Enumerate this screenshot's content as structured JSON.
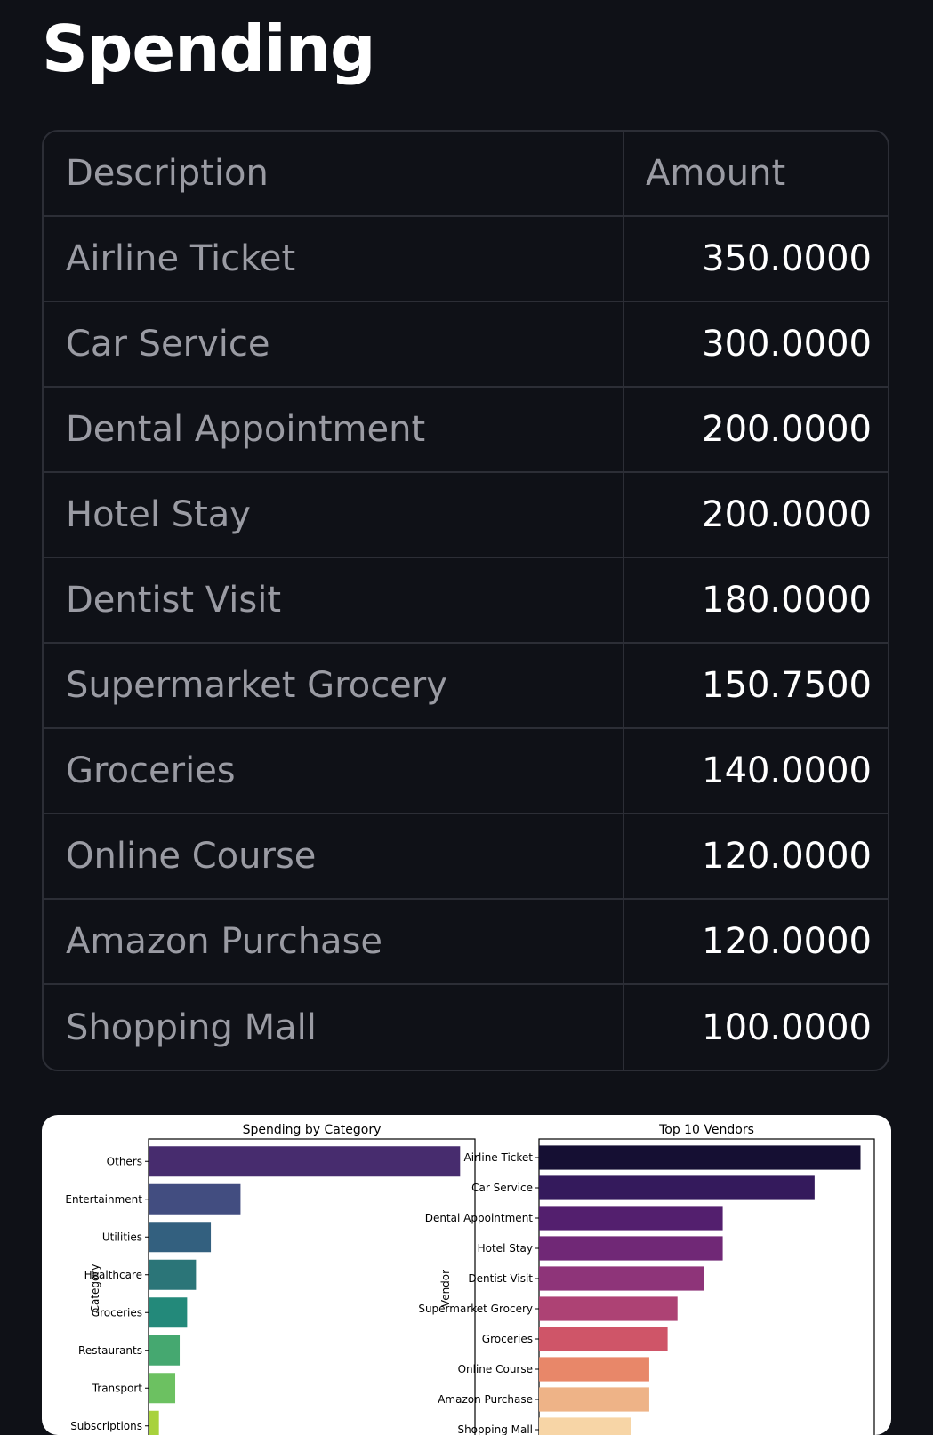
{
  "page": {
    "title": "Spending"
  },
  "table": {
    "headers": [
      "Description",
      "Amount"
    ],
    "rows": [
      {
        "description": "Airline Ticket",
        "amount": "350.0000"
      },
      {
        "description": "Car Service",
        "amount": "300.0000"
      },
      {
        "description": "Dental Appointment",
        "amount": "200.0000"
      },
      {
        "description": "Hotel Stay",
        "amount": "200.0000"
      },
      {
        "description": "Dentist Visit",
        "amount": "180.0000"
      },
      {
        "description": "Supermarket Grocery",
        "amount": "150.7500"
      },
      {
        "description": "Groceries",
        "amount": "140.0000"
      },
      {
        "description": "Online Course",
        "amount": "120.0000"
      },
      {
        "description": "Amazon Purchase",
        "amount": "120.0000"
      },
      {
        "description": "Shopping Mall",
        "amount": "100.0000"
      }
    ]
  },
  "chart_data": [
    {
      "type": "bar",
      "orientation": "horizontal",
      "title": "Spending by Category",
      "ylabel": "Category",
      "xlabel": "",
      "categories": [
        "Others",
        "Entertainment",
        "Utilities",
        "Healthcare",
        "Groceries",
        "Restaurants",
        "Transport",
        "Subscriptions"
      ],
      "values": [
        1050,
        310,
        210,
        160,
        130,
        105,
        90,
        35
      ],
      "xlim": [
        0,
        1100
      ],
      "colors": [
        "#472c6e",
        "#424d80",
        "#33607f",
        "#2b7578",
        "#23897a",
        "#45a870",
        "#6cc161",
        "#a8d23c"
      ]
    },
    {
      "type": "bar",
      "orientation": "horizontal",
      "title": "Top 10 Vendors",
      "ylabel": "Vendor",
      "xlabel": "",
      "categories": [
        "Airline Ticket",
        "Car Service",
        "Dental Appointment",
        "Hotel Stay",
        "Dentist Visit",
        "Supermarket Grocery",
        "Groceries",
        "Online Course",
        "Amazon Purchase",
        "Shopping Mall"
      ],
      "values": [
        350,
        300,
        200,
        200,
        180,
        150.75,
        140,
        120,
        120,
        100
      ],
      "xlim": [
        0,
        365
      ],
      "colors": [
        "#150f33",
        "#341a5c",
        "#531f6e",
        "#702876",
        "#8e3479",
        "#ad4274",
        "#cf5568",
        "#e88769",
        "#eeb387",
        "#f7d5a6"
      ]
    }
  ]
}
